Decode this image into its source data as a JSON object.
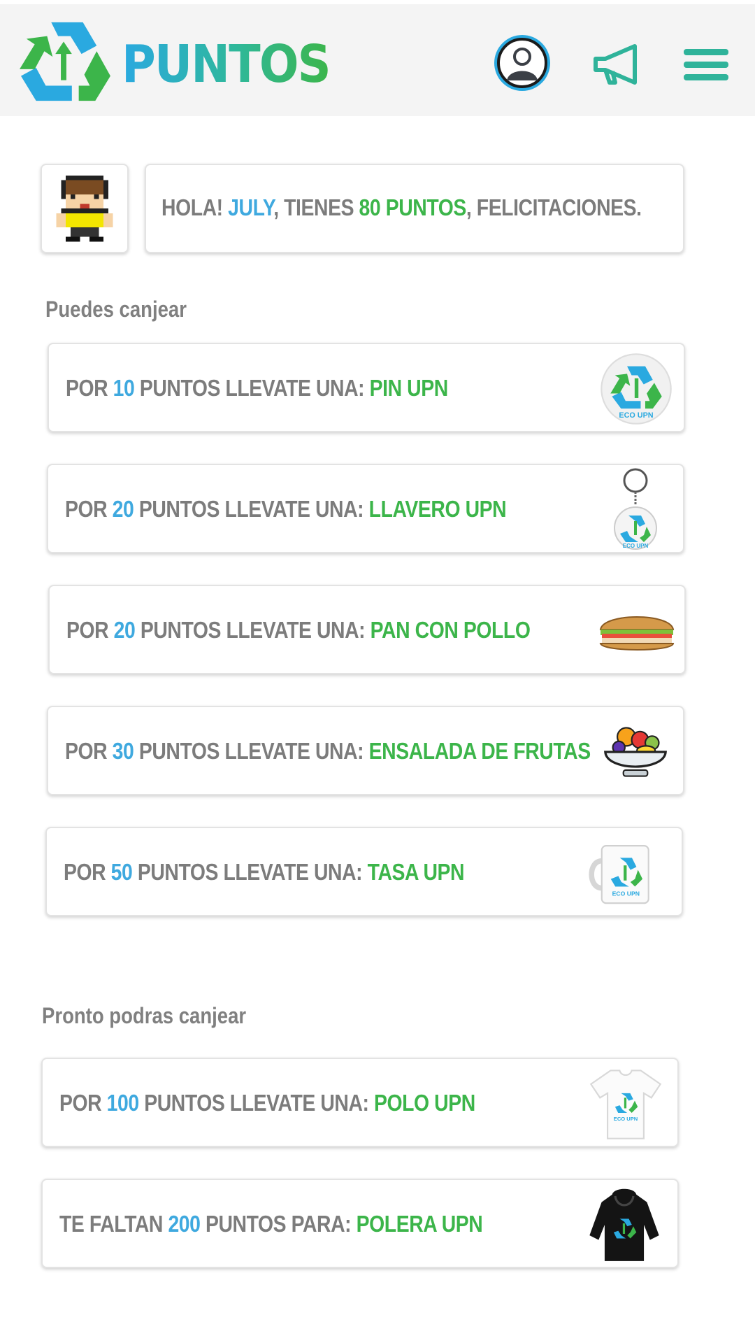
{
  "header": {
    "brand": "PUNTOS",
    "logo_icon": "recycle-arrow-icon",
    "profile_icon": "user-circle-icon",
    "announce_icon": "megaphone-icon",
    "menu_icon": "hamburger-menu-icon"
  },
  "greeting": {
    "hello": "HOLA! ",
    "name": "JULY",
    "mid": ", TIENES ",
    "points": "80 PUNTOS",
    "end": ", FELICITACIONES.",
    "avatar_icon": "pixel-avatar-icon"
  },
  "sections": {
    "redeemable": "Puedes canjear",
    "upcoming": "Pronto podras canjear"
  },
  "rewards": [
    {
      "pre": "POR ",
      "points": "10",
      "mid": " PUNTOS LLEVATE UNA: ",
      "item": "PIN UPN",
      "icon": "eco-upn-pin-icon"
    },
    {
      "pre": "POR ",
      "points": "20",
      "mid": " PUNTOS LLEVATE UNA: ",
      "item": "LLAVERO UPN",
      "icon": "eco-upn-keychain-icon"
    },
    {
      "pre": "POR ",
      "points": "20",
      "mid": " PUNTOS LLEVATE UNA: ",
      "item": "PAN CON POLLO",
      "icon": "sandwich-icon"
    },
    {
      "pre": "POR ",
      "points": "30",
      "mid": " PUNTOS LLEVATE UNA: ",
      "item": "ENSALADA DE FRUTAS",
      "icon": "fruit-salad-icon"
    },
    {
      "pre": "POR ",
      "points": "50",
      "mid": " PUNTOS LLEVATE UNA: ",
      "item": "TASA UPN",
      "icon": "eco-upn-mug-icon"
    }
  ],
  "upcoming": [
    {
      "pre": "POR ",
      "points": "100",
      "mid": " PUNTOS LLEVATE UNA: ",
      "item": "POLO UPN",
      "icon": "eco-upn-tshirt-icon"
    },
    {
      "pre": "TE FALTAN ",
      "points": "200",
      "mid": " PUNTOS PARA: ",
      "item": "POLERA UPN",
      "icon": "eco-upn-hoodie-icon"
    }
  ],
  "colors": {
    "blue": "#3fa9df",
    "green": "#3cb54a",
    "text_gray": "#7c7c7c",
    "header_bg": "#f4f4f4"
  },
  "thumb_label": "ECO UPN"
}
